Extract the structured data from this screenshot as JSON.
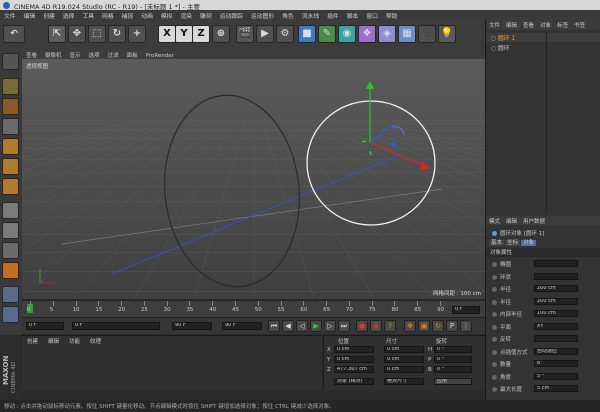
{
  "app": {
    "title": "CINEMA 4D R19.024 Studio (RC - R19) - [未标题 1 *] - 主要"
  },
  "menu": [
    "文件",
    "编辑",
    "创建",
    "选择",
    "工具",
    "网格",
    "捕捉",
    "动画",
    "模拟",
    "渲染",
    "雕刻",
    "运动跟踪",
    "运动图形",
    "角色",
    "流水线",
    "插件",
    "脚本",
    "窗口",
    "帮助"
  ],
  "toolbar": {
    "x_label": "X",
    "y_label": "Y",
    "z_label": "Z"
  },
  "viewport": {
    "menu": [
      "查看",
      "摄像机",
      "显示",
      "选项",
      "过滤",
      "面板",
      "ProRender"
    ],
    "name": "透视视图",
    "grid_spacing": "网格间距 : 100 cm"
  },
  "timeline": {
    "ticks": [
      "0",
      "5",
      "10",
      "15",
      "20",
      "25",
      "30",
      "35",
      "40",
      "45",
      "50",
      "55",
      "60",
      "65",
      "70",
      "75",
      "80",
      "85",
      "90"
    ],
    "end_frame": "0 F"
  },
  "playbar": {
    "start": "0 F",
    "current": "0 F",
    "end": "90 F",
    "max": "90 F"
  },
  "materials": {
    "menu": [
      "创建",
      "编辑",
      "功能",
      "纹理"
    ]
  },
  "coordinates": {
    "headers": [
      "位置",
      "尺寸",
      "旋转"
    ],
    "rows": [
      {
        "axis": "X",
        "pos": "0 cm",
        "size": "0 cm",
        "rot_label": "H",
        "rot": "0 °"
      },
      {
        "axis": "Y",
        "pos": "0 cm",
        "size": "0 cm",
        "rot_label": "P",
        "rot": "0 °"
      },
      {
        "axis": "Z",
        "pos": "477.307 cm",
        "size": "0 cm",
        "rot_label": "B",
        "rot": "0 °"
      }
    ],
    "mode": "对象 (相对)",
    "size_mode": "绝对尺寸",
    "apply": "应用"
  },
  "object_manager": {
    "tabs": [
      "文件",
      "编辑",
      "查看",
      "对象",
      "标签",
      "书签"
    ],
    "objects": [
      "圆环 1",
      "圆环"
    ]
  },
  "attributes": {
    "tabs": [
      "模式",
      "编辑",
      "用户数据"
    ],
    "object_name": "圆环对象 [圆环 1]",
    "subtabs": [
      "基本",
      "坐标",
      "对象"
    ],
    "section": "对象属性",
    "rows": [
      {
        "label": "椭圆",
        "value": ""
      },
      {
        "label": "环状",
        "value": ""
      },
      {
        "label": "半径",
        "value": "200 cm"
      },
      {
        "label": "半径",
        "value": "200 cm"
      },
      {
        "label": "内部半径",
        "value": "100 cm"
      },
      {
        "label": "平面",
        "value": "XY"
      },
      {
        "label": "反转",
        "value": ""
      },
      {
        "label": "点插值方式",
        "value": "自动适应"
      },
      {
        "label": "数量",
        "value": "8"
      },
      {
        "label": "角度",
        "value": "5 °"
      },
      {
        "label": "最大长度",
        "value": "5 cm"
      }
    ]
  },
  "brand": {
    "maxon": "MAXON",
    "c4d": "CINEMA 4D"
  },
  "status": "移动 : 点击并拖动鼠标移动元素。按住 SHIFT 键量化移动。节点编辑模式时按住 SHIFT 键增加选择对象；按住 CTRL 键减少选择对象。"
}
